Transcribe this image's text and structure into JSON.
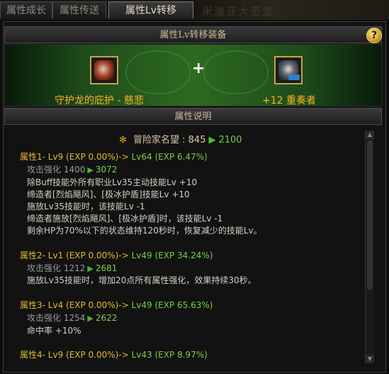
{
  "tabs": [
    {
      "label": "属性成长"
    },
    {
      "label": "属性传送"
    },
    {
      "label": "属性Lv转移"
    }
  ],
  "background_title": "米迪亚大圣堂",
  "section_transfer": {
    "title": "属性Lv转移装备",
    "help": "?"
  },
  "source_item": {
    "name": "守护龙的庇护 - 慈悲",
    "icon": "armor-icon"
  },
  "plus_sign": "+",
  "target_item": {
    "name": "+12 重奏者",
    "icon": "shoulder-armor-icon"
  },
  "section_desc": {
    "title": "属性说明"
  },
  "reputation": {
    "label": "冒险家名望 :",
    "from": "845",
    "to": "2100"
  },
  "attributes": [
    {
      "header_a": "属性1- Lv9 (EXP 0.00%)->",
      "header_b": "Lv64 (EXP 6.47%)",
      "strength_label": "攻击强化",
      "strength_from": "1400",
      "strength_to": "3072",
      "effects": [
        "除Buff技能外所有职业Lv35主动技能Lv +10",
        "缔造者[烈焰飓风]、[极冰护盾]技能Lv +10",
        "施放Lv35技能时，该技能Lv -1",
        "缔造者施放[烈焰飓风]、[极冰护盾]时，该技能Lv -1",
        "剩余HP为70%以下的状态维持120秒时，恢复减少的技能Lv。"
      ]
    },
    {
      "header_a": "属性2- Lv1 (EXP 0.00%)->",
      "header_b": "Lv49 (EXP 34.24%)",
      "strength_label": "攻击强化",
      "strength_from": "1212",
      "strength_to": "2681",
      "effects": [
        "施放Lv35技能时，增加20点所有属性强化，效果持续30秒。"
      ]
    },
    {
      "header_a": "属性3- Lv4 (EXP 0.00%)->",
      "header_b": "Lv49 (EXP 65.63%)",
      "strength_label": "攻击强化",
      "strength_from": "1254",
      "strength_to": "2622",
      "effects": [
        "命中率 +10%"
      ]
    },
    {
      "header_a": "属性4- Lv9 (EXP 0.00%)->",
      "header_b": "Lv43 (EXP 8.97%)"
    }
  ],
  "colors": {
    "gold": "#e3bb2e",
    "green": "#74d040",
    "orange": "#ffb424"
  }
}
